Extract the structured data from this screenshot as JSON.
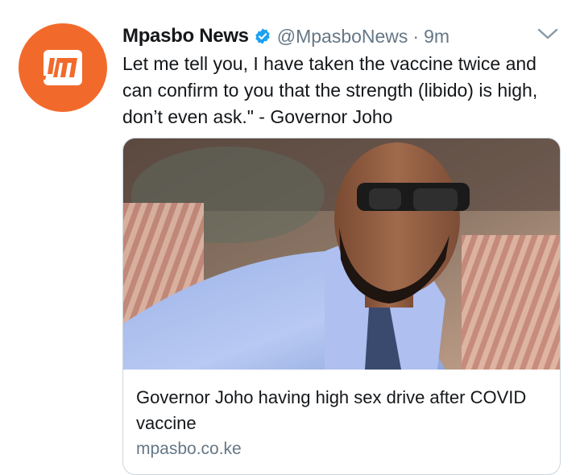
{
  "tweet": {
    "author_name": "Mpasbo News",
    "verified": true,
    "handle": "@MpasboNews",
    "separator": "·",
    "time": "9m",
    "text": "Let me tell you, I have taken the vaccine twice and can confirm to you that the strength (libido) is high, don’t even ask.\" - Governor Joho",
    "avatar": {
      "logo_text": "!M",
      "color": "#f26a2b"
    }
  },
  "card": {
    "image": {
      "description_icon": "man-in-sunglasses-photo"
    },
    "title": "Governor Joho having high sex drive after COVID vaccine",
    "domain": "mpasbo.co.ke"
  },
  "colors": {
    "text": "#14171a",
    "secondary": "#657786",
    "verified": "#1da1f2",
    "border": "#ccd6dd"
  },
  "icons": {
    "verified": "verified-badge-icon",
    "menu": "chevron-down-icon"
  }
}
